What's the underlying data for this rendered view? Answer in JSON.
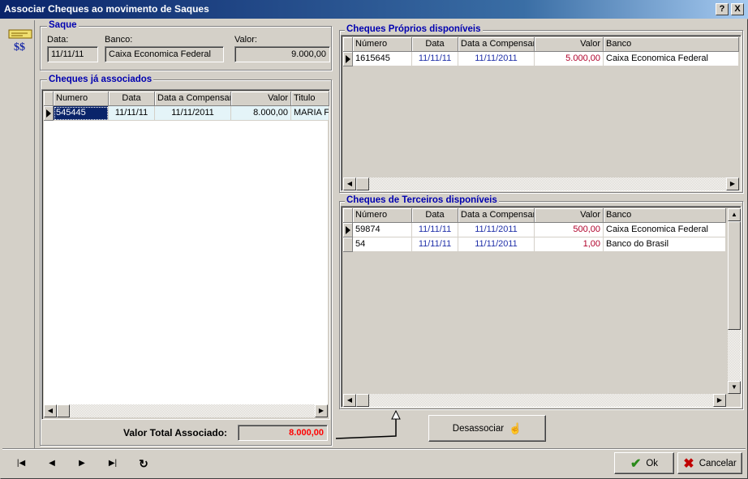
{
  "window": {
    "title": "Associar Cheques ao movimento de Saques",
    "help_btn": "?",
    "close_btn": "X"
  },
  "icon_label": "$$",
  "saque": {
    "legend": "Saque",
    "data_label": "Data:",
    "data_value": "11/11/11",
    "banco_label": "Banco:",
    "banco_value": "Caixa Economica Federal",
    "valor_label": "Valor:",
    "valor_value": "9.000,00"
  },
  "associados": {
    "legend": "Cheques já associados",
    "columns": [
      "Numero",
      "Data",
      "Data a Compensar",
      "Valor",
      "Titulo"
    ],
    "rows": [
      {
        "numero": "545445",
        "data": "11/11/11",
        "compensar": "11/11/2011",
        "valor": "8.000,00",
        "titulo": "MARIA FE"
      }
    ],
    "total_label": "Valor Total Associado:",
    "total_value": "8.000,00"
  },
  "proprios": {
    "legend": "Cheques Próprios disponíveis",
    "columns": [
      "Número",
      "Data",
      "Data a Compensar",
      "Valor",
      "Banco"
    ],
    "rows": [
      {
        "numero": "1615645",
        "data": "11/11/11",
        "compensar": "11/11/2011",
        "valor": "5.000,00",
        "banco": "Caixa Economica Federal"
      }
    ]
  },
  "terceiros": {
    "legend": "Cheques de Terceiros disponíveis",
    "columns": [
      "Número",
      "Data",
      "Data a Compensar",
      "Valor",
      "Banco"
    ],
    "rows": [
      {
        "numero": "59874",
        "data": "11/11/11",
        "compensar": "11/11/2011",
        "valor": "500,00",
        "banco": "Caixa Economica Federal"
      },
      {
        "numero": "54",
        "data": "11/11/11",
        "compensar": "11/11/2011",
        "valor": "1,00",
        "banco": "Banco do Brasil"
      }
    ]
  },
  "buttons": {
    "desassociar": "Desassociar",
    "ok": "Ok",
    "cancelar": "Cancelar"
  },
  "nav": {
    "first": "first-record-icon",
    "prior": "prior-record-icon",
    "next": "next-record-icon",
    "last": "last-record-icon",
    "refresh": "refresh-icon"
  },
  "colors": {
    "title_start": "#0a246a",
    "legend_text": "#0000b0",
    "total_text": "#ff0000",
    "value_text": "#b0002a",
    "date_text": "#1f2fa8",
    "selected_row": "#0a246a"
  }
}
